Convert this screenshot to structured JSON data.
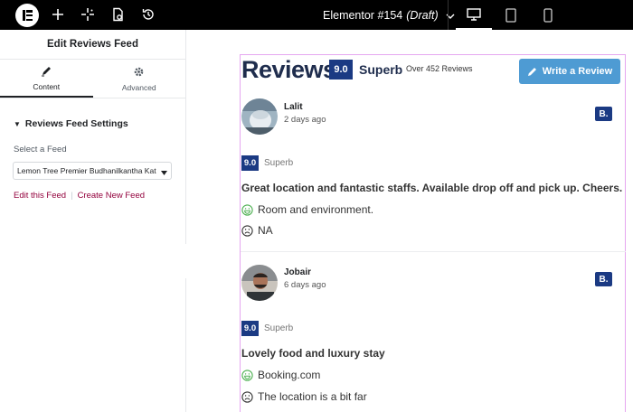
{
  "topbar": {
    "logo": "elementor-logo",
    "icons": [
      "plus-icon",
      "sparkle-icon",
      "page-settings-icon",
      "history-icon"
    ],
    "document_name": "Elementor #154",
    "document_status": "(Draft)",
    "devices": [
      "desktop-icon",
      "tablet-icon",
      "mobile-icon"
    ],
    "active_device": "desktop"
  },
  "panel": {
    "title": "Edit Reviews Feed",
    "tabs": [
      {
        "label": "Content",
        "icon": "pencil-icon",
        "active": true
      },
      {
        "label": "Advanced",
        "icon": "gear-icon",
        "active": false
      }
    ],
    "section_title": "Reviews Feed Settings",
    "select_label": "Select a Feed",
    "select_value": "Lemon Tree Premier Budhanilkantha Kat",
    "edit_link": "Edit this Feed",
    "separator": "|",
    "create_link": "Create New Feed"
  },
  "header": {
    "title": "Reviews",
    "score": "9.0",
    "rating_word": "Superb",
    "count_text": "Over 452 Reviews",
    "write_button": "Write a Review"
  },
  "reviews": [
    {
      "name": "Lalit",
      "date": "2 days ago",
      "source_badge": "B.",
      "score": "9.0",
      "score_label": "Superb",
      "title": "Great location and fantastic staffs. Available drop off and pick up. Cheers.",
      "positive": "Room and environment.",
      "negative": "NA"
    },
    {
      "name": "Jobair",
      "date": "6 days ago",
      "source_badge": "B.",
      "score": "9.0",
      "score_label": "Superb",
      "title": "Lovely food and luxury stay",
      "positive": "Booking.com",
      "negative": "The location is a bit far"
    }
  ],
  "colors": {
    "topbar_bg": "#000000",
    "brand_navy": "#1b3a83",
    "button_blue": "#4e9bd3",
    "link_color": "#93003c",
    "selection_outline": "#e6a7f0",
    "positive_face": "#4caf50"
  }
}
